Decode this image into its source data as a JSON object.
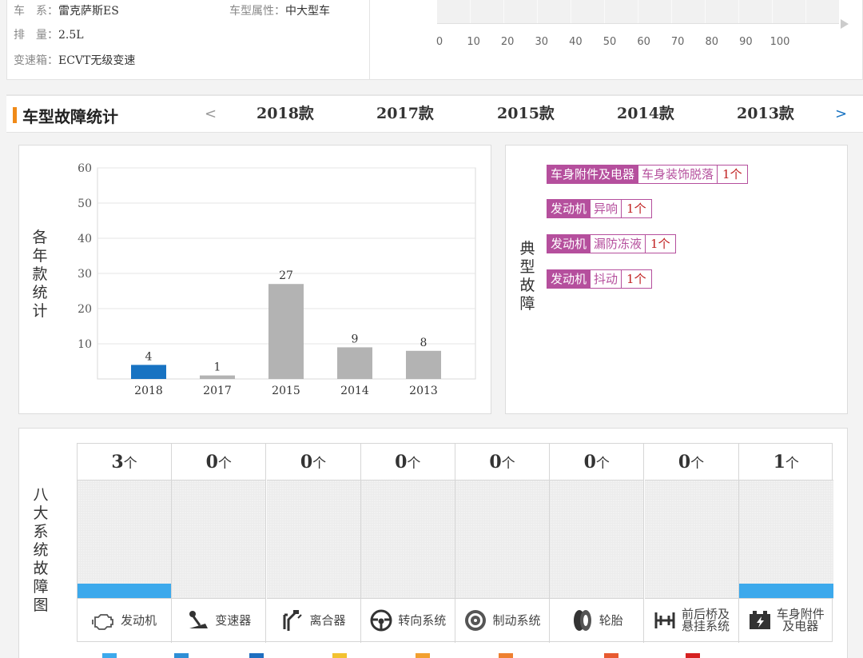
{
  "car_info": {
    "series_label": "车　系：",
    "series_value": "雷克萨斯ES",
    "attr_label": "车型属性：",
    "attr_value": "中大型车",
    "displacement_label": "排　量：",
    "displacement_value": "2.5L",
    "transmission_label": "变速箱：",
    "transmission_value": "ECVT无级变速"
  },
  "scale": {
    "ticks": [
      "0",
      "10",
      "20",
      "30",
      "40",
      "50",
      "60",
      "70",
      "80",
      "90",
      "100"
    ]
  },
  "tabs": {
    "title": "车型故障统计",
    "prev": "<",
    "next": ">",
    "items": [
      {
        "label": "2018款",
        "active": true
      },
      {
        "label": "2017款",
        "active": false
      },
      {
        "label": "2015款",
        "active": false
      },
      {
        "label": "2014款",
        "active": false
      },
      {
        "label": "2013款",
        "active": false
      }
    ]
  },
  "year_chart": {
    "vertical_label": "各年款统计",
    "chart_data": {
      "type": "bar",
      "categories": [
        "2018",
        "2017",
        "2015",
        "2014",
        "2013"
      ],
      "values": [
        4,
        1,
        27,
        9,
        8
      ],
      "highlight_index": 0,
      "ylim": [
        0,
        60
      ],
      "yticks": [
        10,
        20,
        30,
        40,
        50,
        60
      ],
      "grid": true,
      "colors": {
        "highlight": "#1873c2",
        "default": "#b3b3b3"
      }
    }
  },
  "typical": {
    "vertical_label": "典型故障",
    "items": [
      {
        "category": "车身附件及电器",
        "description": "车身装饰脱落",
        "count": "1个"
      },
      {
        "category": "发动机",
        "description": "异响",
        "count": "1个"
      },
      {
        "category": "发动机",
        "description": "漏防冻液",
        "count": "1个"
      },
      {
        "category": "发动机",
        "description": "抖动",
        "count": "1个"
      }
    ]
  },
  "eight_systems": {
    "vertical_label": "八大系统故障图",
    "unit": "个",
    "systems": [
      {
        "name": "发动机",
        "count": "3",
        "fill": 0.12,
        "icon": "engine-icon"
      },
      {
        "name": "变速器",
        "count": "0",
        "fill": 0,
        "icon": "gear-shift-icon"
      },
      {
        "name": "离合器",
        "count": "0",
        "fill": 0,
        "icon": "clutch-pedal-icon"
      },
      {
        "name": "转向系统",
        "count": "0",
        "fill": 0,
        "icon": "steering-wheel-icon"
      },
      {
        "name": "制动系统",
        "count": "0",
        "fill": 0,
        "icon": "brake-disc-icon"
      },
      {
        "name": "轮胎",
        "count": "0",
        "fill": 0,
        "icon": "tire-icon"
      },
      {
        "name": "前后桥及\n悬挂系统",
        "count": "0",
        "fill": 0,
        "icon": "axle-icon"
      },
      {
        "name": "车身附件\n及电器",
        "count": "1",
        "fill": 0.12,
        "icon": "battery-icon"
      }
    ]
  },
  "colors": {
    "accent": "#1873c2",
    "tab_marker": "#f08a18",
    "fault_purple": "#b54f9d",
    "fault_count": "#c02020",
    "system_fill": "#3ca9ec"
  }
}
